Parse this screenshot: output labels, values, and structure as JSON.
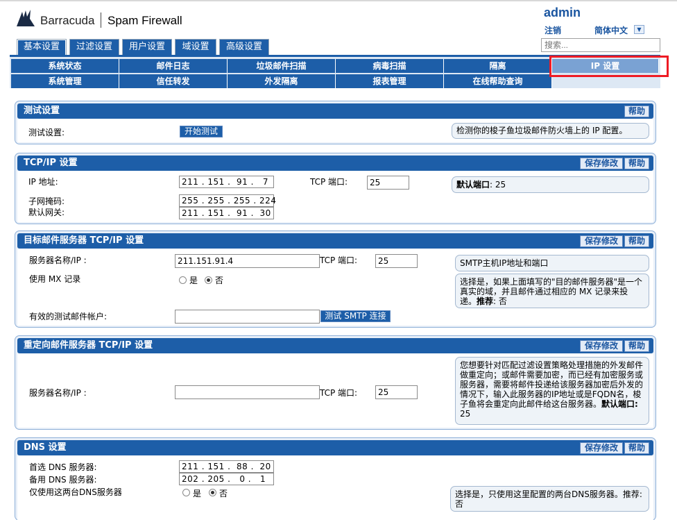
{
  "header": {
    "brand": "Barracuda",
    "product": "Spam Firewall",
    "user": "admin",
    "logout": "注销",
    "language": "简体中文",
    "search_placeholder": "搜索..."
  },
  "main_tabs": [
    "基本设置",
    "过滤设置",
    "用户设置",
    "域设置",
    "高级设置"
  ],
  "subnav": {
    "row1": [
      "系统状态",
      "邮件日志",
      "垃圾邮件扫描",
      "病毒扫描",
      "隔离",
      "IP 设置"
    ],
    "row2": [
      "系统管理",
      "信任转发",
      "外发隔离",
      "报表管理",
      "在线帮助查询"
    ],
    "selected": "IP 设置"
  },
  "buttons": {
    "help": "帮助",
    "save": "保存修改"
  },
  "test_panel": {
    "title": "测试设置",
    "label": "测试设置:",
    "button": "开始测试",
    "help": "检测你的梭子鱼垃圾邮件防火墙上的 IP 配置。"
  },
  "tcpip_panel": {
    "title": "TCP/IP 设置",
    "ip_label": "IP 地址:",
    "ip_value": "211 . 151 .  91 .   7",
    "mask_label": "子网掩码:",
    "mask_value": "255 . 255 . 255 . 224",
    "gw_label": "默认网关:",
    "gw_value": "211 . 151 .  91 .  30",
    "port_label": "TCP 端口:",
    "port_value": "25",
    "help_bold": "默认端口",
    "help_text": ": 25"
  },
  "dest_panel": {
    "title": "目标邮件服务器 TCP/IP 设置",
    "server_label": "服务器名称/IP :",
    "server_value": "211.151.91.4",
    "port_label": "TCP 端口:",
    "port_value": "25",
    "help1": "SMTP主机IP地址和端口",
    "mx_label": "使用 MX 记录",
    "yes": "是",
    "no": "否",
    "mx_selected": "否",
    "help2": "选择是，如果上面填写的\"目的邮件服务器\"是一个真实的域，并且邮件通过相应的 MX 记录来投递。",
    "help2_bold": "推荐",
    "help2_tail": ": 否",
    "test_label": "有效的测试邮件帐户:",
    "test_button": "测试 SMTP 连接"
  },
  "redirect_panel": {
    "title": "重定向邮件服务器 TCP/IP 设置",
    "server_label": "服务器名称/IP :",
    "port_label": "TCP 端口:",
    "port_value": "25",
    "help": "您想要针对匹配过滤设置策略处理措施的外发邮件做重定向；或邮件需要加密，而已经有加密服务或服务器，需要将邮件投递给该服务器加密后外发的情况下，输入此服务器的IP地址或是FQDN名，梭子鱼将会重定向此邮件给这台服务器。",
    "help_bold": "默认端口:",
    "help_tail": "25"
  },
  "dns_panel": {
    "title": "DNS 设置",
    "primary_label": "首选 DNS 服务器:",
    "primary_value": "211 . 151 .  88 .  20",
    "secondary_label": "备用 DNS 服务器:",
    "secondary_value": "202 . 205 .   0 .   1",
    "only_label": "仅使用这两台DNS服务器",
    "yes": "是",
    "no": "否",
    "selected": "否",
    "help": "选择是，只使用这里配置的两台DNS服务器。推荐: 否"
  },
  "colors": {
    "header_blue": "#1d5ea8",
    "highlight_red": "#ee1b24"
  }
}
